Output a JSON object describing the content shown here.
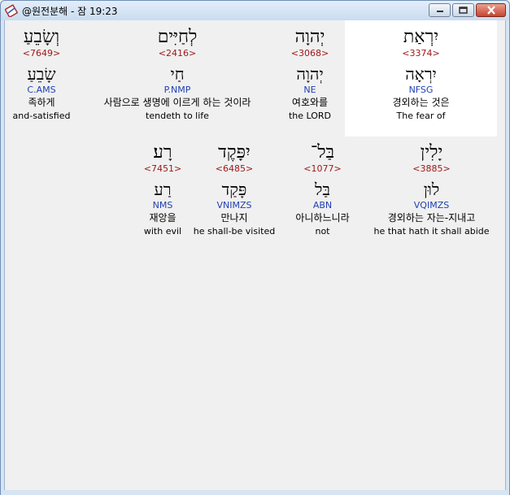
{
  "window": {
    "title": "@원전분해 - 잠 19:23",
    "buttons": {
      "minimize": "minimize",
      "maximize": "maximize",
      "close": "close"
    }
  },
  "words": [
    {
      "hebrew": "יִרְאַת",
      "strong": "<3374>",
      "lemma": "יִרְאָה",
      "morph": "NFSG",
      "korean": "경외하는 것은",
      "english": "The fear of",
      "highlight": true
    },
    {
      "hebrew": "יְהוָה",
      "strong": "<3068>",
      "lemma": "יְהוָה",
      "morph": "NE",
      "korean": "여호와를",
      "english": "the LORD",
      "highlight": false
    },
    {
      "hebrew": "לְחַיִּים",
      "strong": "<2416>",
      "lemma": "חַי",
      "morph": "P.NMP",
      "korean": "사람으로 생명에 이르게 하는 것이라",
      "english": "tendeth to life",
      "highlight": false
    },
    {
      "hebrew": "וְשָׂבֵעַ",
      "strong": "<7649>",
      "lemma": "שָׂבֵעַ",
      "morph": "C.AMS",
      "korean": "족하게",
      "english": "and-satisfied",
      "highlight": false
    },
    {
      "hebrew": "יָלִין",
      "strong": "<3885>",
      "lemma": "לוּן",
      "morph": "VQIMZS",
      "korean": "경외하는 자는-지내고",
      "english": "he that hath it shall abide",
      "highlight": false
    },
    {
      "hebrew": "בַּל־",
      "strong": "<1077>",
      "lemma": "בַּל",
      "morph": "ABN",
      "korean": "아니하느니라",
      "english": "not",
      "highlight": false
    },
    {
      "hebrew": "יִפָּקֶד",
      "strong": "<6485>",
      "lemma": "פָּקַד",
      "morph": "VNIMZS",
      "korean": "만나지",
      "english": "he shall-be visited",
      "highlight": false
    },
    {
      "hebrew": "רָע׃",
      "strong": "<7451>",
      "lemma": "רַע",
      "morph": "NMS",
      "korean": "재앙을",
      "english": "with evil",
      "highlight": false
    }
  ],
  "colors": {
    "strong": "#a01818",
    "morph": "#1f3fb4",
    "highlight": "#ffffff",
    "background": "#f0f0f0"
  }
}
